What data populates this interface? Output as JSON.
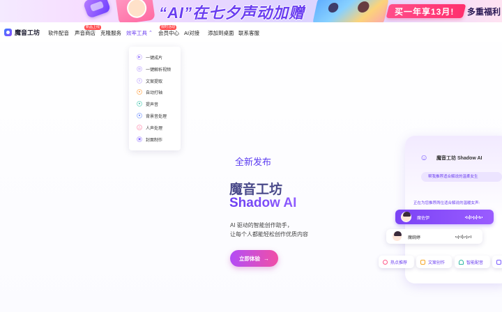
{
  "banner": {
    "headline": "“AI”在七夕声动加赠",
    "promo": "买一年享13月!",
    "extra": "多重福利"
  },
  "brand": {
    "name": "魔音工坊"
  },
  "nav": {
    "items": [
      {
        "label": "软件配音"
      },
      {
        "label": "声音商店",
        "badge": "新品上线"
      },
      {
        "label": "克隆服务"
      },
      {
        "label": "效率工具"
      },
      {
        "label": "会员中心",
        "badge": "限时活动"
      },
      {
        "label": "AI对接"
      },
      {
        "label": "添加到桌面"
      },
      {
        "label": "联系客服"
      }
    ]
  },
  "dropdown": {
    "items": [
      {
        "label": "一键成片",
        "icon": "film-icon"
      },
      {
        "label": "一键解析视频",
        "icon": "video-parse-icon"
      },
      {
        "label": "文案提取",
        "icon": "text-extract-icon"
      },
      {
        "label": "自动打轴",
        "icon": "timeline-icon"
      },
      {
        "label": "提声音",
        "icon": "voice-extract-icon"
      },
      {
        "label": "背景音处理",
        "icon": "bgm-icon"
      },
      {
        "label": "人声处理",
        "icon": "vocal-icon"
      },
      {
        "label": "封面制作",
        "icon": "cover-icon"
      }
    ]
  },
  "hero": {
    "tag": "全新发布",
    "title": "魔音工坊",
    "subtitle": "Shadow AI",
    "desc_line1": "AI 驱动的智能创作助手，",
    "desc_line2": "让每个人都能轻松创作优质内容",
    "cta": "立即体验"
  },
  "preview": {
    "title": "魔音工坊 Shadow AI",
    "bubble": "帮我推荐适合解说的温柔女生",
    "status": "正在为您推荐两位适合解说的温暖女声:",
    "voices": [
      {
        "name": "魔佐伊"
      },
      {
        "name": "魔婉婷"
      }
    ],
    "chips": [
      {
        "label": "热点推荐",
        "color": "#ff5a8a"
      },
      {
        "label": "文案创作",
        "color": "#f5a524"
      },
      {
        "label": "智能配音",
        "color": "#2bb5a0"
      }
    ]
  },
  "colors": {
    "accent": "#6a3df0",
    "cta_start": "#b34df6",
    "cta_end": "#f04fa6",
    "badge": "#ff4d4f"
  }
}
